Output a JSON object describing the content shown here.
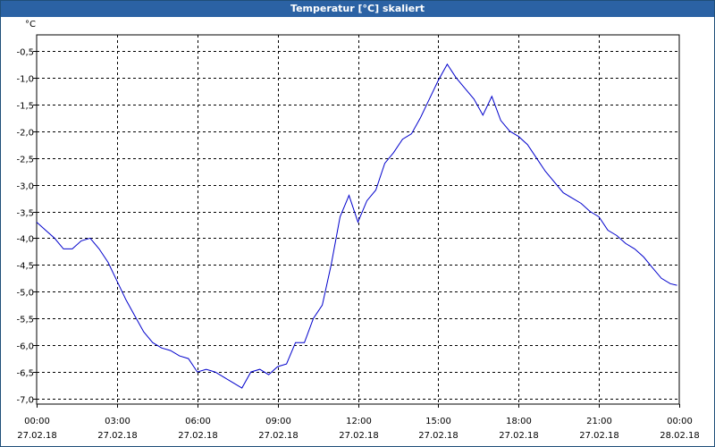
{
  "window": {
    "title": "Temperatur [°C] skaliert"
  },
  "chart_data": {
    "type": "line",
    "title": "Temperatur [°C] skaliert",
    "ylabel": "°C",
    "xlabel": "",
    "ylim": [
      -7.1,
      -0.2
    ],
    "xlim_hours": [
      0,
      24
    ],
    "y_ticks": [
      "-0,5",
      "-1,0",
      "-1,5",
      "-2,0",
      "-2,5",
      "-3,0",
      "-3,5",
      "-4,0",
      "-4,5",
      "-5,0",
      "-5,5",
      "-6,0",
      "-6,5",
      "-7,0"
    ],
    "x_ticks": [
      {
        "time": "00:00",
        "date": "27.02.18"
      },
      {
        "time": "03:00",
        "date": "27.02.18"
      },
      {
        "time": "06:00",
        "date": "27.02.18"
      },
      {
        "time": "09:00",
        "date": "27.02.18"
      },
      {
        "time": "12:00",
        "date": "27.02.18"
      },
      {
        "time": "15:00",
        "date": "27.02.18"
      },
      {
        "time": "18:00",
        "date": "27.02.18"
      },
      {
        "time": "21:00",
        "date": "27.02.18"
      },
      {
        "time": "00:00",
        "date": "28.02.18"
      }
    ],
    "grid": true,
    "line_color": "#0000cc",
    "series": [
      {
        "x": [
          "27.02.18 00:00",
          "27.02.18 00:20",
          "27.02.18 00:40",
          "27.02.18 01:00",
          "27.02.18 01:20",
          "27.02.18 01:40",
          "27.02.18 02:00",
          "27.02.18 02:20",
          "27.02.18 02:40",
          "27.02.18 03:00",
          "27.02.18 03:20",
          "27.02.18 03:40",
          "27.02.18 04:00",
          "27.02.18 04:20",
          "27.02.18 04:40",
          "27.02.18 05:00",
          "27.02.18 05:20",
          "27.02.18 05:40",
          "27.02.18 06:00",
          "27.02.18 06:20",
          "27.02.18 06:40",
          "27.02.18 07:00",
          "27.02.18 07:20",
          "27.02.18 07:40",
          "27.02.18 08:00",
          "27.02.18 08:20",
          "27.02.18 08:40",
          "27.02.18 09:00",
          "27.02.18 09:20",
          "27.02.18 09:40",
          "27.02.18 10:00",
          "27.02.18 10:20",
          "27.02.18 10:40",
          "27.02.18 11:00",
          "27.02.18 11:20",
          "27.02.18 11:40",
          "27.02.18 12:00",
          "27.02.18 12:20",
          "27.02.18 12:40",
          "27.02.18 13:00",
          "27.02.18 13:20",
          "27.02.18 13:40",
          "27.02.18 14:00",
          "27.02.18 14:20",
          "27.02.18 14:40",
          "27.02.18 15:00",
          "27.02.18 15:20",
          "27.02.18 15:40",
          "27.02.18 16:00",
          "27.02.18 16:20",
          "27.02.18 16:40",
          "27.02.18 17:00",
          "27.02.18 17:20",
          "27.02.18 17:40",
          "27.02.18 18:00",
          "27.02.18 18:20",
          "27.02.18 18:40",
          "27.02.18 19:00",
          "27.02.18 19:20",
          "27.02.18 19:40",
          "27.02.18 20:00",
          "27.02.18 20:20",
          "27.02.18 20:40",
          "27.02.18 21:00",
          "27.02.18 21:20",
          "27.02.18 21:40",
          "27.02.18 22:00",
          "27.02.18 22:20",
          "27.02.18 22:40",
          "27.02.18 23:00",
          "27.02.18 23:20",
          "27.02.18 23:40",
          "27.02.18 23:55"
        ],
        "y": [
          -3.7,
          -3.85,
          -4.0,
          -4.2,
          -4.2,
          -4.05,
          -4.0,
          -4.2,
          -4.45,
          -4.8,
          -5.15,
          -5.45,
          -5.75,
          -5.95,
          -6.05,
          -6.1,
          -6.2,
          -6.25,
          -6.5,
          -6.45,
          -6.5,
          -6.6,
          -6.7,
          -6.8,
          -6.5,
          -6.45,
          -6.55,
          -6.4,
          -6.35,
          -5.95,
          -5.95,
          -5.5,
          -5.25,
          -4.5,
          -3.6,
          -3.2,
          -3.7,
          -3.3,
          -3.1,
          -2.6,
          -2.4,
          -2.15,
          -2.05,
          -1.75,
          -1.4,
          -1.05,
          -0.75,
          -1.0,
          -1.2,
          -1.4,
          -1.7,
          -1.35,
          -1.8,
          -2.0,
          -2.1,
          -2.25,
          -2.5,
          -2.75,
          -2.95,
          -3.15,
          -3.25,
          -3.35,
          -3.5,
          -3.6,
          -3.85,
          -3.95,
          -4.1,
          -4.2,
          -4.35,
          -4.55,
          -4.75,
          -4.85,
          -4.88
        ]
      }
    ]
  }
}
